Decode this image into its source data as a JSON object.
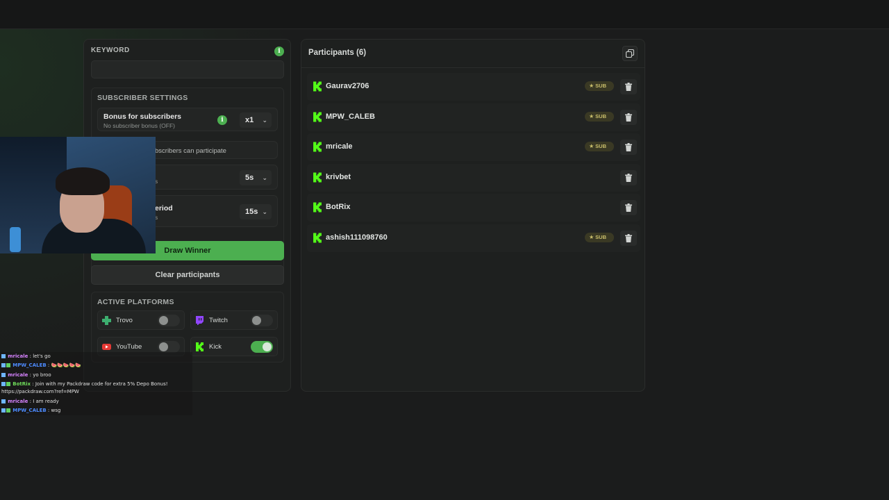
{
  "left_panel": {
    "keyword_label": "KEYWORD",
    "keyword_value": "",
    "subscriber_settings_title": "SUBSCRIBER SETTINGS",
    "bonus_label": "Bonus for subscribers",
    "bonus_sub": "No subscriber bonus (OFF)",
    "bonus_value": "x1",
    "only_subs_label": "bscribers can participate",
    "timer_partial": "s",
    "timer_value": "5s",
    "period_label": "eriod",
    "period_sub": "s",
    "period_value": "15s",
    "draw_winner": "Draw Winner",
    "clear_participants": "Clear participants",
    "active_platforms_title": "ACTIVE PLATFORMS",
    "platforms": [
      {
        "name": "Trovo",
        "enabled": false,
        "color": "#3dae6f"
      },
      {
        "name": "Twitch",
        "enabled": false,
        "color": "#9146ff"
      },
      {
        "name": "YouTube",
        "enabled": false,
        "color": "#e53935"
      },
      {
        "name": "Kick",
        "enabled": true,
        "color": "#53fc18"
      }
    ]
  },
  "participants": {
    "title": "Participants (6)",
    "sub_label": "SUB",
    "items": [
      {
        "name": "Gaurav2706",
        "sub": true
      },
      {
        "name": "MPW_CALEB",
        "sub": true
      },
      {
        "name": "mricale",
        "sub": true
      },
      {
        "name": "krivbet",
        "sub": false
      },
      {
        "name": "BotRix",
        "sub": false
      },
      {
        "name": "ashish111098760",
        "sub": true
      }
    ]
  },
  "chat": {
    "lines": [
      {
        "user": "mricale",
        "msg": ": let's go",
        "cls": "u-pink"
      },
      {
        "user": "MPW_CALEB",
        "msg": ": 🍉🍉🍉🍉🍉",
        "cls": "u-blue"
      },
      {
        "user": "mricale",
        "msg": ": yo broo",
        "cls": "u-pink"
      },
      {
        "user": "BotRix",
        "msg": ": Join with my Packdraw code for extra 5% Depo Bonus!",
        "cls": "u-green"
      },
      {
        "user": "",
        "msg": "https://packdraw.com?ref=MPW",
        "cls": ""
      },
      {
        "user": "mricale",
        "msg": ": I am ready",
        "cls": "u-pink"
      },
      {
        "user": "MPW_CALEB",
        "msg": ": wsg",
        "cls": "u-blue"
      }
    ]
  },
  "colors": {
    "accent": "#4caf50",
    "background": "#1b1c1c",
    "panel": "#1e201f"
  }
}
